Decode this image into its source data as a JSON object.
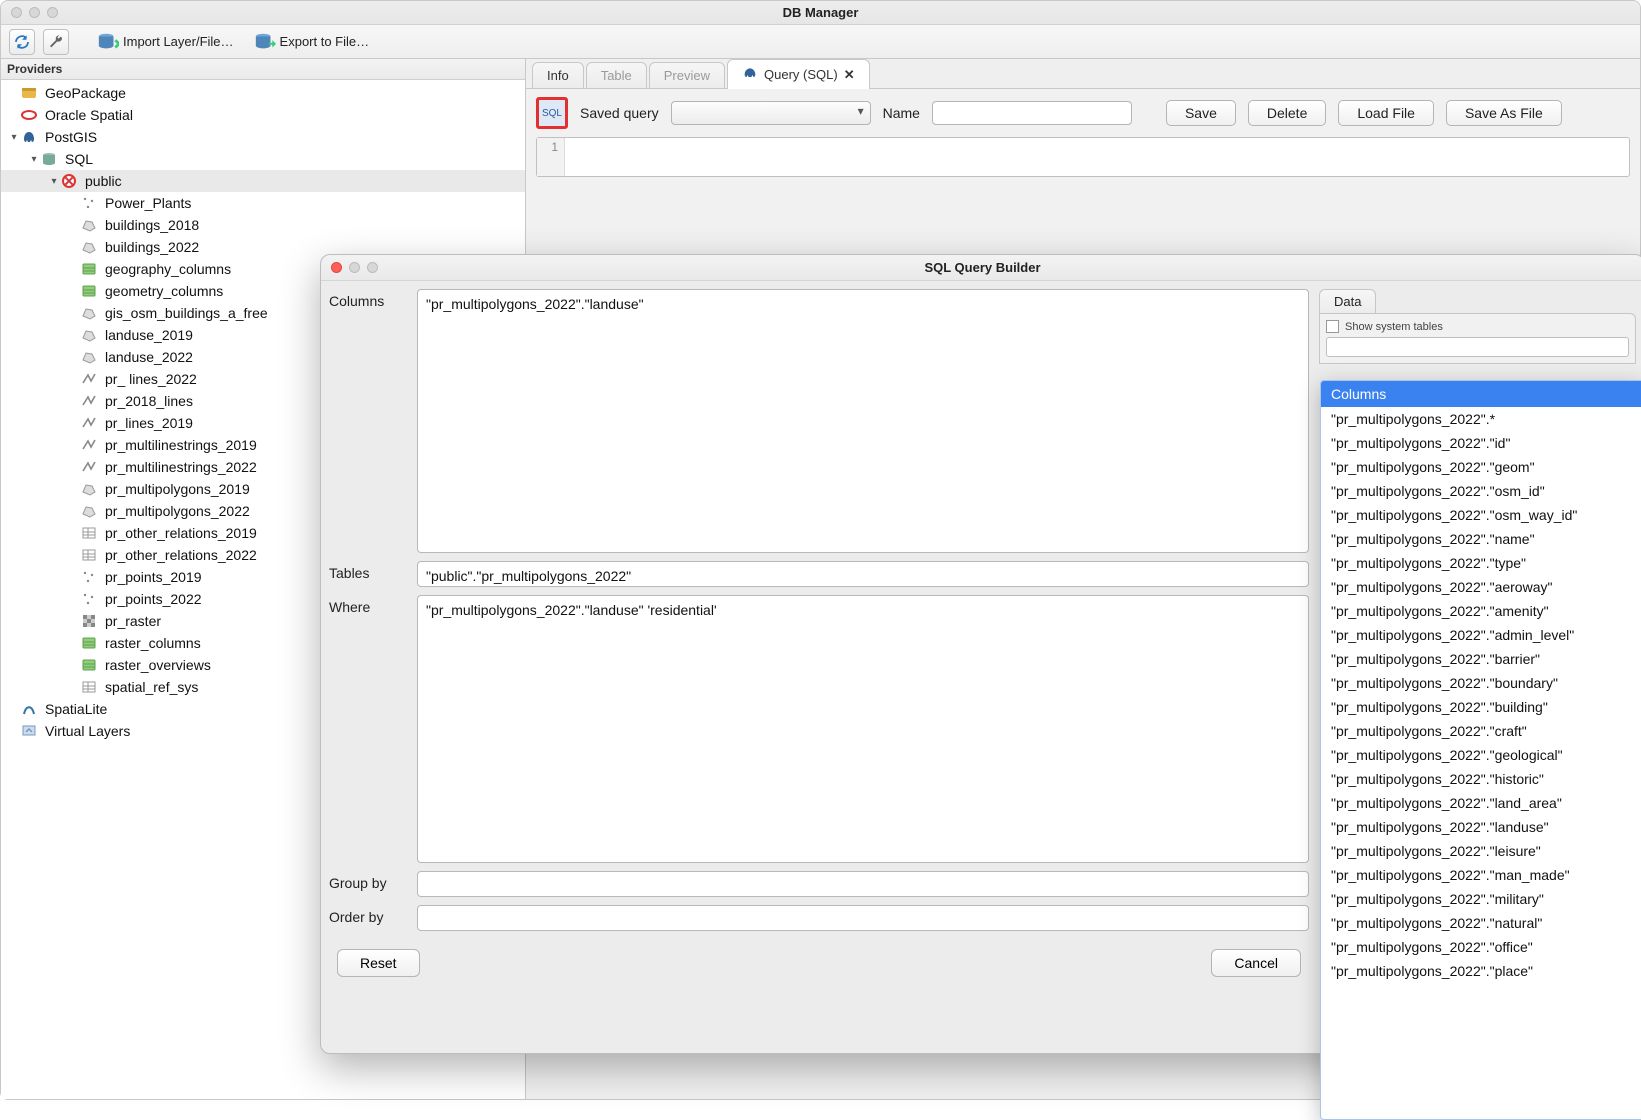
{
  "window": {
    "title": "DB Manager"
  },
  "toolbar": {
    "import_label": "Import Layer/File…",
    "export_label": "Export to File…"
  },
  "left": {
    "header": "Providers",
    "providers": [
      {
        "label": "GeoPackage",
        "icon": "geopackage"
      },
      {
        "label": "Oracle Spatial",
        "icon": "oracle"
      },
      {
        "label": "PostGIS",
        "icon": "postgis",
        "expanded": true,
        "children": [
          {
            "label": "SQL",
            "icon": "db",
            "expanded": true,
            "children": [
              {
                "label": "public",
                "icon": "schema",
                "selected": true,
                "expanded": true,
                "children": [
                  {
                    "label": "Power_Plants",
                    "icon": "point"
                  },
                  {
                    "label": "buildings_2018",
                    "icon": "poly"
                  },
                  {
                    "label": "buildings_2022",
                    "icon": "poly"
                  },
                  {
                    "label": "geography_columns",
                    "icon": "tablesys"
                  },
                  {
                    "label": "geometry_columns",
                    "icon": "tablesys"
                  },
                  {
                    "label": "gis_osm_buildings_a_free",
                    "icon": "poly"
                  },
                  {
                    "label": "landuse_2019",
                    "icon": "poly"
                  },
                  {
                    "label": "landuse_2022",
                    "icon": "poly"
                  },
                  {
                    "label": "pr_ lines_2022",
                    "icon": "line"
                  },
                  {
                    "label": "pr_2018_lines",
                    "icon": "line"
                  },
                  {
                    "label": "pr_lines_2019",
                    "icon": "line"
                  },
                  {
                    "label": "pr_multilinestrings_2019",
                    "icon": "line"
                  },
                  {
                    "label": "pr_multilinestrings_2022",
                    "icon": "line"
                  },
                  {
                    "label": "pr_multipolygons_2019",
                    "icon": "poly"
                  },
                  {
                    "label": "pr_multipolygons_2022",
                    "icon": "poly"
                  },
                  {
                    "label": "pr_other_relations_2019",
                    "icon": "table"
                  },
                  {
                    "label": "pr_other_relations_2022",
                    "icon": "table"
                  },
                  {
                    "label": "pr_points_2019",
                    "icon": "point"
                  },
                  {
                    "label": "pr_points_2022",
                    "icon": "point"
                  },
                  {
                    "label": "pr_raster",
                    "icon": "raster"
                  },
                  {
                    "label": "raster_columns",
                    "icon": "tablesys"
                  },
                  {
                    "label": "raster_overviews",
                    "icon": "tablesys"
                  },
                  {
                    "label": "spatial_ref_sys",
                    "icon": "table"
                  }
                ]
              }
            ]
          }
        ]
      },
      {
        "label": "SpatiaLite",
        "icon": "spatialite"
      },
      {
        "label": "Virtual Layers",
        "icon": "virtual"
      }
    ]
  },
  "tabs": {
    "info": "Info",
    "table": "Table",
    "preview": "Preview",
    "query": "Query (SQL)"
  },
  "querybar": {
    "saved_label": "Saved query",
    "name_label": "Name",
    "save": "Save",
    "delete": "Delete",
    "load": "Load File",
    "saveas": "Save As File"
  },
  "code": {
    "gutter1": "1"
  },
  "dialog": {
    "title": "SQL Query Builder",
    "labels": {
      "columns": "Columns",
      "tables": "Tables",
      "where": "Where",
      "groupby": "Group by",
      "orderby": "Order by"
    },
    "values": {
      "columns": "\"pr_multipolygons_2022\".\"landuse\"",
      "tables": "\"public\".\"pr_multipolygons_2022\"",
      "where": "\"pr_multipolygons_2022\".\"landuse\" 'residential'",
      "groupby": "",
      "orderby": ""
    },
    "buttons": {
      "reset": "Reset",
      "cancel": "Cancel"
    },
    "data": {
      "tab": "Data",
      "show_system": "Show system tables"
    },
    "columns_popup_header": "Columns",
    "columns_popup": [
      "\"pr_multipolygons_2022\".*",
      "\"pr_multipolygons_2022\".\"id\"",
      "\"pr_multipolygons_2022\".\"geom\"",
      "\"pr_multipolygons_2022\".\"osm_id\"",
      "\"pr_multipolygons_2022\".\"osm_way_id\"",
      "\"pr_multipolygons_2022\".\"name\"",
      "\"pr_multipolygons_2022\".\"type\"",
      "\"pr_multipolygons_2022\".\"aeroway\"",
      "\"pr_multipolygons_2022\".\"amenity\"",
      "\"pr_multipolygons_2022\".\"admin_level\"",
      "\"pr_multipolygons_2022\".\"barrier\"",
      "\"pr_multipolygons_2022\".\"boundary\"",
      "\"pr_multipolygons_2022\".\"building\"",
      "\"pr_multipolygons_2022\".\"craft\"",
      "\"pr_multipolygons_2022\".\"geological\"",
      "\"pr_multipolygons_2022\".\"historic\"",
      "\"pr_multipolygons_2022\".\"land_area\"",
      "\"pr_multipolygons_2022\".\"landuse\"",
      "\"pr_multipolygons_2022\".\"leisure\"",
      "\"pr_multipolygons_2022\".\"man_made\"",
      "\"pr_multipolygons_2022\".\"military\"",
      "\"pr_multipolygons_2022\".\"natural\"",
      "\"pr_multipolygons_2022\".\"office\"",
      "\"pr_multipolygons_2022\".\"place\""
    ]
  }
}
